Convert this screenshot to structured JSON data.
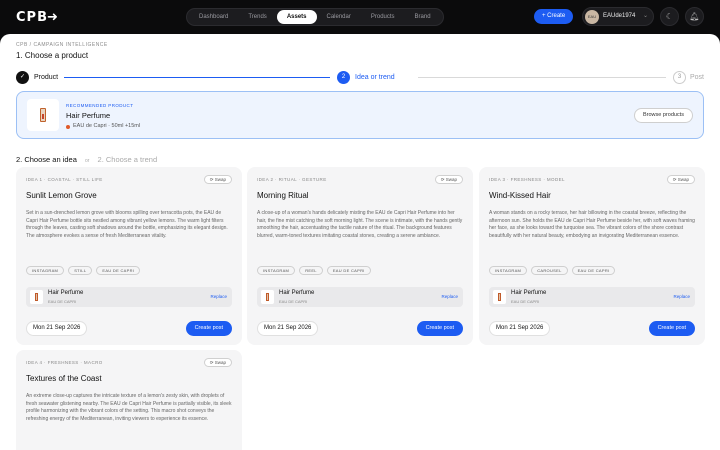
{
  "header": {
    "logo": "CPB",
    "nav": [
      "Dashboard",
      "Trends",
      "Assets",
      "Calendar",
      "Products",
      "Brand"
    ],
    "active_nav": "Assets",
    "create_label": "+ Create",
    "user_initials": "EAU",
    "user_name": "EAUde1974"
  },
  "page": {
    "breadcrumb": "CPB / CAMPAIGN INTELLIGENCE",
    "title": "1. Choose a product"
  },
  "stepper": [
    {
      "num": "✓",
      "label": "Product",
      "state": "done"
    },
    {
      "num": "2",
      "label": "Idea or trend",
      "state": "active"
    },
    {
      "num": "3",
      "label": "Post",
      "state": "pending"
    }
  ],
  "product": {
    "badge": "RECOMMENDED PRODUCT",
    "name": "Hair Perfume",
    "subtitle": "EAU de Capri · 50ml +15ml",
    "browse_label": "Browse products"
  },
  "section2": {
    "title": "2. Choose an idea",
    "or": "or",
    "alt": "2. Choose a trend"
  },
  "ideas": [
    {
      "tag": "IDEA 1 · COASTAL · STILL LIFE",
      "swap": "⟳ Swap",
      "title": "Sunlit Lemon Grove",
      "desc": "Set in a sun-drenched lemon grove with blooms spilling over terracotta pots, the EAU de Capri Hair Perfume bottle sits nestled among vibrant yellow lemons. The warm light filters through the leaves, casting soft shadows around the bottle, emphasizing its elegant design. The atmosphere evokes a sense of fresh Mediterranean vitality.",
      "chips": [
        "INSTAGRAM",
        "STILL",
        "EAU DE CAPRI"
      ],
      "product_name": "Hair Perfume",
      "product_brand": "EAU DE CAPRI",
      "replace": "Replace",
      "date": "Mon 21 Sep 2026",
      "cta": "Create post"
    },
    {
      "tag": "IDEA 2 · RITUAL · GESTURE",
      "swap": "⟳ Swap",
      "title": "Morning Ritual",
      "desc": "A close-up of a woman's hands delicately misting the EAU de Capri Hair Perfume into her hair, the fine mist catching the soft morning light. The scene is intimate, with the hands gently smoothing the hair, accentuating the tactile nature of the ritual. The background features blurred, warm-toned textures imitating coastal stones, creating a serene ambiance.",
      "chips": [
        "INSTAGRAM",
        "REEL",
        "EAU DE CAPRI"
      ],
      "product_name": "Hair Perfume",
      "product_brand": "EAU DE CAPRI",
      "replace": "Replace",
      "date": "Mon 21 Sep 2026",
      "cta": "Create post"
    },
    {
      "tag": "IDEA 3 · FRESHNESS · MODEL",
      "swap": "⟳ Swap",
      "title": "Wind-Kissed Hair",
      "desc": "A woman stands on a rocky terrace, her hair billowing in the coastal breeze, reflecting the afternoon sun. She holds the EAU de Capri Hair Perfume beside her, with soft waves framing her face, as she looks toward the turquoise sea. The vibrant colors of the shore contrast beautifully with her natural beauty, embodying an invigorating Mediterranean essence.",
      "chips": [
        "INSTAGRAM",
        "CAROUSEL",
        "EAU DE CAPRI"
      ],
      "product_name": "Hair Perfume",
      "product_brand": "EAU DE CAPRI",
      "replace": "Replace",
      "date": "Mon 21 Sep 2026",
      "cta": "Create post"
    },
    {
      "tag": "IDEA 4 · FRESHNESS · MACRO",
      "swap": "⟳ Swap",
      "title": "Textures of the Coast",
      "desc": "An extreme close-up captures the intricate texture of a lemon's zesty skin, with droplets of fresh seawater glistening nearby. The EAU de Capri Hair Perfume is partially visible, its sleek profile harmonizing with the vibrant colors of the setting. This macro shot conveys the refreshing energy of the Mediterranean, inviting viewers to experience its essence."
    }
  ],
  "colors": {
    "accent": "#1d5cf2",
    "dark": "#0b0b0c"
  }
}
